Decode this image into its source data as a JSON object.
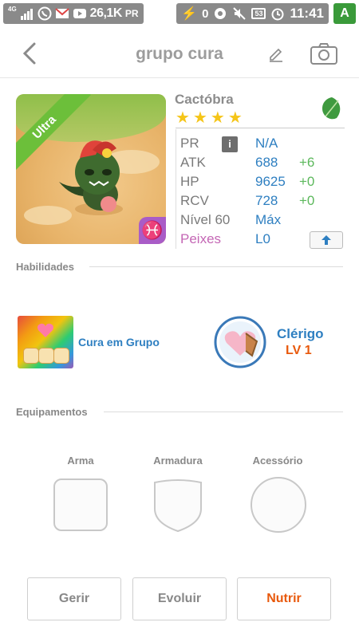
{
  "status_bar": {
    "network": "4G",
    "counter": "26,1K",
    "pr_label": "PR",
    "notifications_count": "0",
    "battery": "53",
    "time": "11:41"
  },
  "header": {
    "title": "grupo cura",
    "icons": {
      "back": "chevron-left-icon",
      "edit": "pencil-icon",
      "camera": "camera-icon"
    }
  },
  "creature": {
    "rarity": "Ultra",
    "name": "Cactóbra",
    "stars": 4,
    "element_icon": "leaf-icon",
    "sign_icon": "pisces-icon",
    "stats": [
      {
        "label": "PR",
        "value": "N/A",
        "bonus": ""
      },
      {
        "label": "ATK",
        "value": "688",
        "bonus": "+6"
      },
      {
        "label": "HP",
        "value": "9625",
        "bonus": "+0"
      },
      {
        "label": "RCV",
        "value": "728",
        "bonus": "+0"
      },
      {
        "label": "Nível 60",
        "value": "Máx",
        "bonus": ""
      },
      {
        "label": "Peixes",
        "value": "L0",
        "bonus": ""
      }
    ]
  },
  "abilities": {
    "title": "Habilidades",
    "skill": "Cura em Grupo",
    "class_name": "Clérigo",
    "class_level": "LV 1"
  },
  "equipment": {
    "title": "Equipamentos",
    "weapon": "Arma",
    "armor": "Armadura",
    "accessory": "Acessório"
  },
  "actions": {
    "manage": "Gerir",
    "evolve": "Evoluir",
    "feed": "Nutrir"
  },
  "colors": {
    "accent_blue": "#2e7fc1",
    "bonus_green": "#5cb85c",
    "level_orange": "#e8590c",
    "pisces_purple": "#c467b5",
    "ultra_green": "#6cbf3a"
  }
}
